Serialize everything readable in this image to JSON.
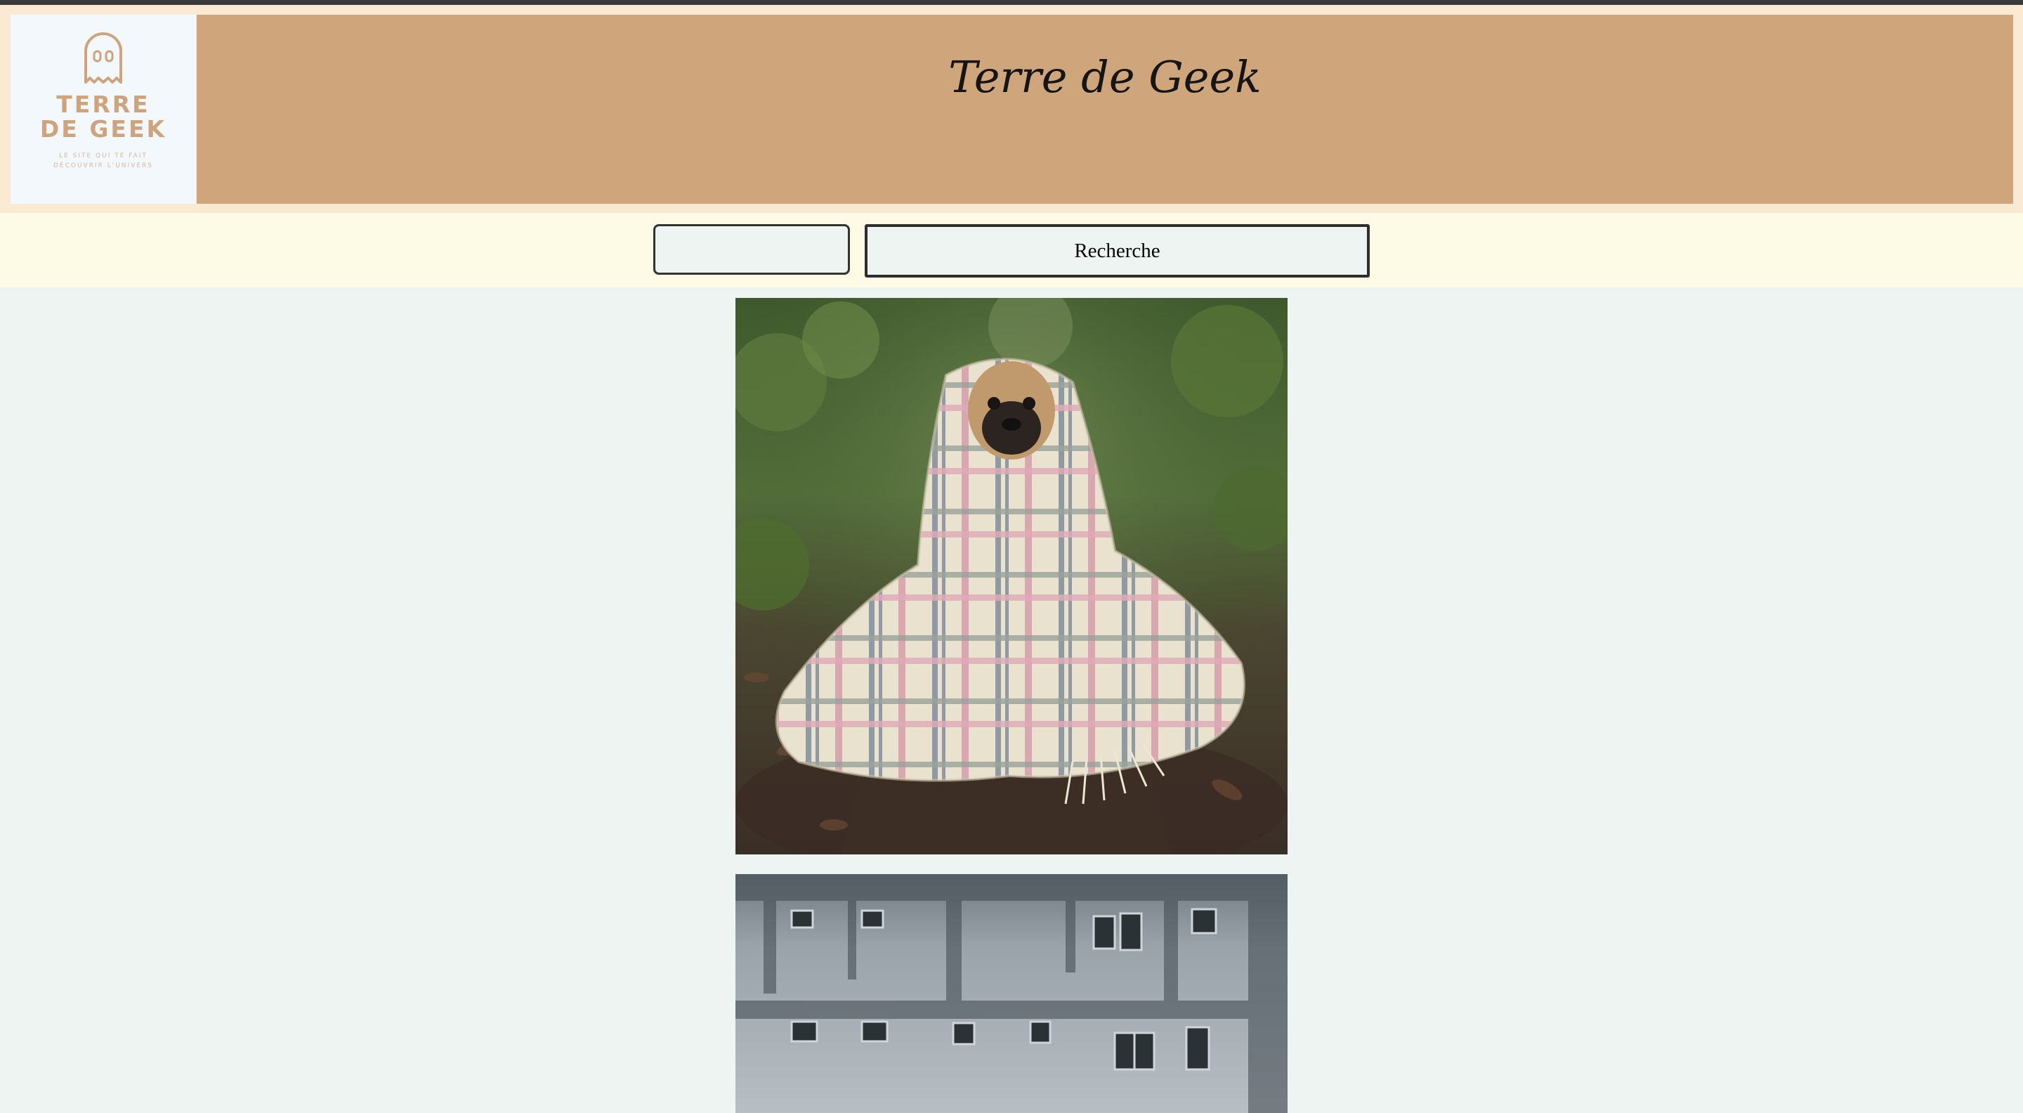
{
  "site": {
    "title": "Terre de Geek"
  },
  "logo": {
    "icon": "ghost-icon",
    "title": "TERRE DE GEEK",
    "tagline": "LE SITE QUI TE FAIT DÉCOUVRIR L'UNIVERS"
  },
  "search": {
    "value": "",
    "placeholder": "",
    "button_label": "Recherche"
  },
  "gallery": [
    {
      "subject": "pug-in-blanket"
    },
    {
      "subject": "weathered-building"
    }
  ],
  "colors": {
    "banner": "#cfa57c",
    "header_band": "#fbead3",
    "search_band": "#fdfae5",
    "page_background": "#edf4f2",
    "logo_accent": "#cfa47d"
  }
}
